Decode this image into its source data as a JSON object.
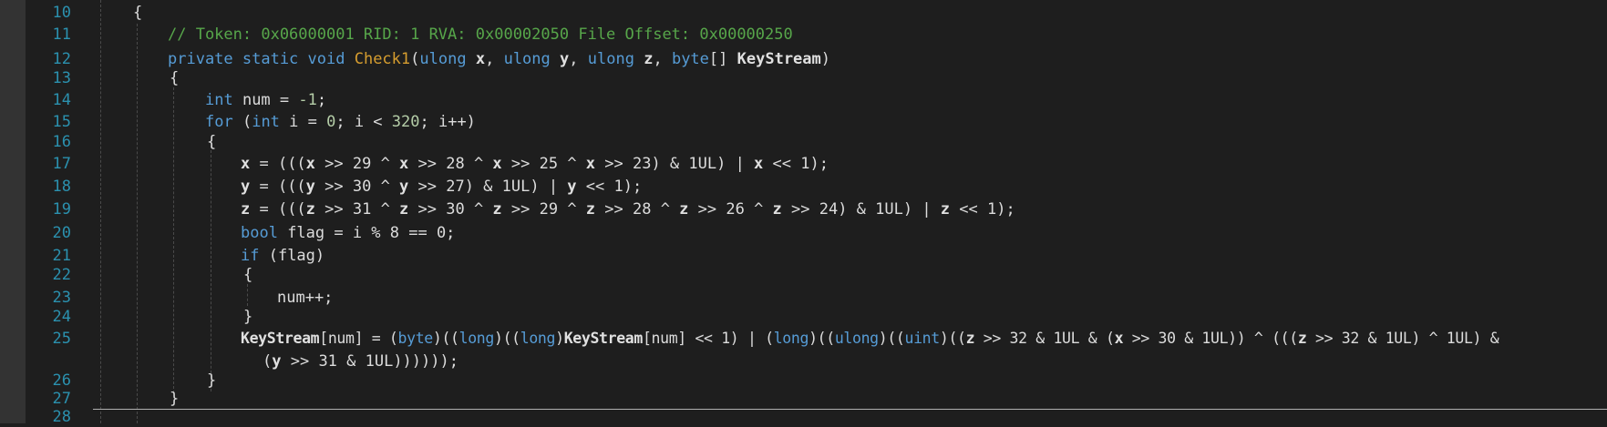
{
  "theme": {
    "background": "#1e1e1e",
    "line_number": "#2b91af",
    "keyword": "#569cd6",
    "comment": "#57a64a",
    "method": "#d69d2f",
    "number": "#b5cea8",
    "plain": "#dcdcdc"
  },
  "line_numbers": [
    "10",
    "11",
    "12",
    "13",
    "14",
    "15",
    "16",
    "17",
    "18",
    "19",
    "20",
    "21",
    "22",
    "23",
    "24",
    "25",
    "",
    "26",
    "27",
    "28"
  ],
  "code": {
    "l10": "{",
    "l11": "// Token: 0x06000001 RID: 1 RVA: 0x00002050 File Offset: 0x00000250",
    "l12": {
      "kw1": "private static void",
      "name": "Check1",
      "p1": "(",
      "t1": "ulong",
      "a1": "x",
      "c1": ",",
      "t2": "ulong",
      "a2": "y",
      "c2": ",",
      "t3": "ulong",
      "a3": "z",
      "c3": ",",
      "t4": "byte",
      "arr": "[]",
      "a4": "KeyStream",
      "p2": ")"
    },
    "l13": "{",
    "l14": {
      "kw": "int",
      "rest": " num = ",
      "num": "-1",
      "end": ";"
    },
    "l15": {
      "kw": "for",
      "p1": " (",
      "kw2": "int",
      "rest1": " i = ",
      "n1": "0",
      "rest2": "; i < ",
      "n2": "320",
      "rest3": "; i++)"
    },
    "l16": "{",
    "l17": {
      "v": "x",
      "t1": " = (((",
      "v1": "x",
      "t2": " >> 29 ^ ",
      "v2": "x",
      "t3": " >> 28 ^ ",
      "v3": "x",
      "t4": " >> 25 ^ ",
      "v4": "x",
      "t5": " >> 23) & 1UL) | ",
      "v5": "x",
      "t6": " << 1);"
    },
    "l18": {
      "v": "y",
      "t1": " = (((",
      "v1": "y",
      "t2": " >> 30 ^ ",
      "v2": "y",
      "t3": " >> 27) & 1UL) | ",
      "v3": "y",
      "t4": " << 1);"
    },
    "l19": {
      "v": "z",
      "t1": " = (((",
      "v1": "z",
      "t2": " >> 31 ^ ",
      "v2": "z",
      "t3": " >> 30 ^ ",
      "v3": "z",
      "t4": " >> 29 ^ ",
      "v4": "z",
      "t5": " >> 28 ^ ",
      "v5": "z",
      "t6": " >> 26 ^ ",
      "v6": "z",
      "t7": " >> 24) & 1UL) | ",
      "v7": "z",
      "t8": " << 1);"
    },
    "l20": {
      "kw": "bool",
      "rest": " flag = i % 8 == 0;"
    },
    "l21": {
      "kw": "if",
      "rest": " (flag)"
    },
    "l22": "{",
    "l23": "num++;",
    "l24": "}",
    "l25": {
      "ks": "KeyStream",
      "t1": "[num] = (",
      "k1": "byte",
      "t2": ")((",
      "k2": "long",
      "t3": ")((",
      "k3": "long",
      "t4": ")",
      "ks2": "KeyStream",
      "t5": "[num] << 1) | (",
      "k4": "long",
      "t6": ")((",
      "k5": "ulong",
      "t7": ")((",
      "k6": "uint",
      "t8": ")((",
      "z1": "z",
      "t9": " >> 32 & 1UL & (",
      "x1": "x",
      "t10": " >> 30 & 1UL)) ^ (((",
      "z2": "z",
      "t11": " >> 32 & 1UL) ^ 1UL) &"
    },
    "l25b": {
      "t1": "(",
      "y1": "y",
      "t2": " >> 31 & 1UL))))));"
    },
    "l26": "}",
    "l27": "}"
  }
}
